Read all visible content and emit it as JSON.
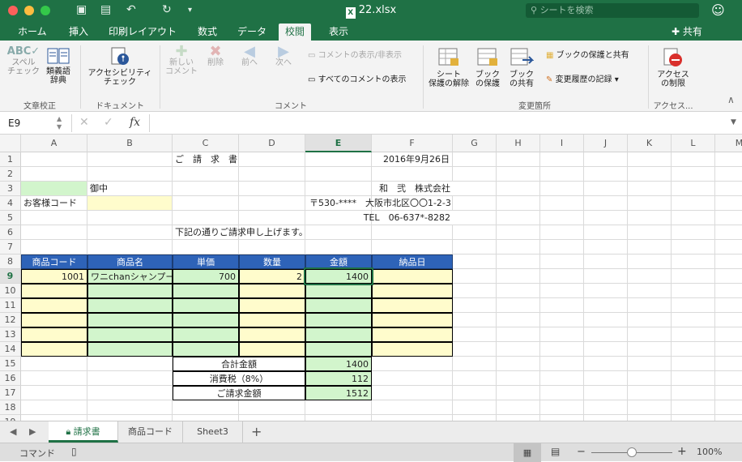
{
  "window": {
    "filename": "22.xlsx",
    "search_placeholder": "シートを検索"
  },
  "tabs": [
    "ホーム",
    "挿入",
    "印刷レイアウト",
    "数式",
    "データ",
    "校閲",
    "表示"
  ],
  "active_tab": "校閲",
  "share_label": "共有",
  "ribbon": {
    "spelling": "スペル\nチェック",
    "thesaurus": "類義語\n辞典",
    "group_proofing": "文章校正",
    "accessibility": "アクセシビリティ\nチェック",
    "group_document": "ドキュメント",
    "new_comment": "新しい\nコメント",
    "delete": "削除",
    "previous": "前へ",
    "next": "次へ",
    "show_hide_comment": "コメントの表示/非表示",
    "show_all_comments": "すべてのコメントの表示",
    "group_comments": "コメント",
    "unprotect_sheet": "シート\n保護の解除",
    "protect_book": "ブック\nの保護",
    "share_book": "ブック\nの共有",
    "protect_and_share": "ブックの保護と共有",
    "track_changes": "変更履歴の記録",
    "group_changes": "変更箇所",
    "restrict_access": "アクセス\nの制限",
    "group_access": "アクセス..."
  },
  "formula_bar": {
    "name_box": "E9",
    "fx": "fx",
    "formula": ""
  },
  "columns": [
    "A",
    "B",
    "C",
    "D",
    "E",
    "F",
    "G",
    "H",
    "I",
    "J",
    "K",
    "L",
    "M"
  ],
  "selected_column": "E",
  "rows": [
    "1",
    "2",
    "3",
    "4",
    "5",
    "6",
    "7",
    "8",
    "9",
    "10",
    "11",
    "12",
    "13",
    "14",
    "15",
    "16",
    "17",
    "18",
    "19"
  ],
  "selected_row": "9",
  "cells": {
    "C1": "ご　請　求　書",
    "F1": "2016年9月26日",
    "B3": "御中",
    "F3": "和　弐　株式会社",
    "A4": "お客様コード",
    "F4": "〒530-****　大阪市北区〇〇1-2-3",
    "F5": "TEL　06-637*-8282",
    "C6": "下記の通りご請求申し上げます。",
    "A8": "商品コード",
    "B8": "商品名",
    "C8": "単価",
    "D8": "数量",
    "E8": "金額",
    "F8": "納品日",
    "A9": "1001",
    "B9": "ワニchanシャンプー",
    "C9": "700",
    "D9": "2",
    "E9": "1400",
    "C15": "合計金額",
    "E15": "1400",
    "C16": "消費税（8%）",
    "E16": "112",
    "C17": "ご請求金額",
    "E17": "1512"
  },
  "sheet_tabs": [
    "請求書",
    "商品コード",
    "Sheet3"
  ],
  "active_sheet": "請求書",
  "status": {
    "mode": "コマンド",
    "zoom": "100%"
  }
}
